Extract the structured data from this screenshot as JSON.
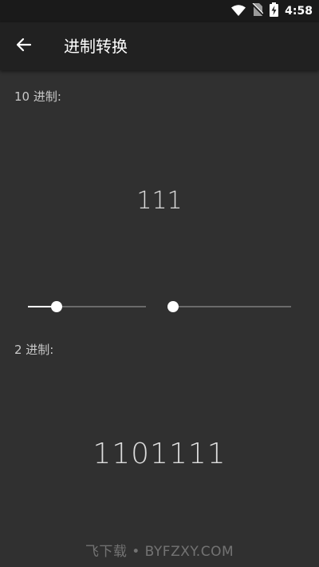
{
  "status_bar": {
    "time": "4:58",
    "icons": [
      "wifi-icon",
      "no-sim-icon",
      "battery-charging-icon"
    ]
  },
  "app_bar": {
    "back_icon": "arrow-left-icon",
    "title": "进制转换"
  },
  "decimal": {
    "label": "10 进制:",
    "value": "111"
  },
  "sliders": [
    {
      "name": "left-slider",
      "value": 0.24
    },
    {
      "name": "right-slider",
      "value": 0.0
    }
  ],
  "binary": {
    "label": "2 进制:",
    "value": "1101111"
  },
  "watermark": "飞下载 • BYFZXY.COM",
  "colors": {
    "background": "#303030",
    "app_bar": "#212121",
    "status_bar": "#1a1a1a",
    "text": "#dcdcdc",
    "accent": "#ffffff"
  }
}
